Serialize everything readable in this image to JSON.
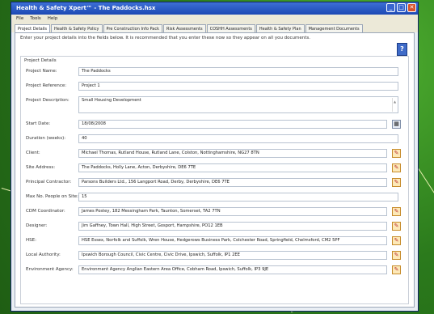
{
  "window": {
    "title": "Health & Safety Xpert™ - The Paddocks.hsx",
    "minimize_glyph": "_",
    "maximize_glyph": "□",
    "close_glyph": "✕"
  },
  "menu": [
    "File",
    "Tools",
    "Help"
  ],
  "tabs": [
    "Project Details",
    "Health & Safety Policy",
    "Pre Construction Info Pack",
    "Risk Assessments",
    "COSHH Assessments",
    "Health & Safety Plan",
    "Management Documents"
  ],
  "intro_text": "Enter your project details into the fields below. It is recommended that you enter these now so they appear on all you documents.",
  "group_title": "Project Details",
  "fields": [
    {
      "label": "Project Name:",
      "value": "The Paddocks"
    },
    {
      "label": "Project Reference:",
      "value": "Project 1"
    },
    {
      "label": "Project Description:",
      "value": "Small Housing Development"
    },
    {
      "label": "Start Date:",
      "value": "18/08/2008"
    },
    {
      "label": "Duration (weeks):",
      "value": "40"
    },
    {
      "label": "Client:",
      "value": "Michael Thomas, Rutland House, Rutland Lane, Colston, Nottinghamshire, NG27 8TN"
    },
    {
      "label": "Site Address:",
      "value": "The Paddocks, Holly Lane, Acton, Derbyshire, DE6 7TE"
    },
    {
      "label": "Principal Contractor:",
      "value": "Parsons Builders Ltd., 156 Langport Road, Derby, Derbyshire, DE6 7TE"
    },
    {
      "label": "Max No. People on Site:",
      "value": "15"
    },
    {
      "label": "CDM Coordinator:",
      "value": "James Postey, 182 Messingham Park, Taunton, Somerset, TA2 7TN"
    },
    {
      "label": "Designer:",
      "value": "Jim Gaffney, Town Hall, High Street, Gosport, Hampshire, PO12 1EB"
    },
    {
      "label": "HSE:",
      "value": "HSE Essex, Norfolk and Suffolk, Wren House, Hedgerows Business Park, Colchester Road, Springfield, Chelmsford, CM2 5PF"
    },
    {
      "label": "Local Authority:",
      "value": "Ipswich Borough Council, Civic Centre, Civic Drive, Ipswich, Suffolk, IP1 2EE"
    },
    {
      "label": "Environment Agency:",
      "value": "Environment Agency Anglian Eastern Area Office, Cobham Road, Ipswich, Suffolk, IP3 9JE"
    }
  ],
  "icons": {
    "help": "help-book-icon",
    "calendar": "calendar-icon",
    "address_book": "address-book-icon"
  },
  "colors": {
    "titlebar": "#1c49b4",
    "background": "#2f8a1f",
    "callout": "#e8f0b0"
  }
}
